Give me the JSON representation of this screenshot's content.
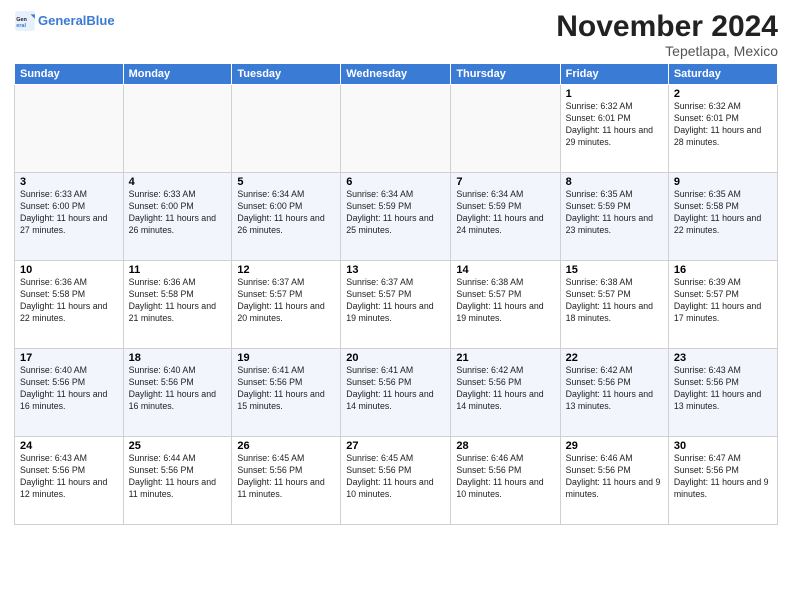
{
  "header": {
    "logo_line1": "General",
    "logo_line2": "Blue",
    "month": "November 2024",
    "location": "Tepetlapa, Mexico"
  },
  "days_of_week": [
    "Sunday",
    "Monday",
    "Tuesday",
    "Wednesday",
    "Thursday",
    "Friday",
    "Saturday"
  ],
  "weeks": [
    [
      {
        "day": "",
        "info": ""
      },
      {
        "day": "",
        "info": ""
      },
      {
        "day": "",
        "info": ""
      },
      {
        "day": "",
        "info": ""
      },
      {
        "day": "",
        "info": ""
      },
      {
        "day": "1",
        "info": "Sunrise: 6:32 AM\nSunset: 6:01 PM\nDaylight: 11 hours and 29 minutes."
      },
      {
        "day": "2",
        "info": "Sunrise: 6:32 AM\nSunset: 6:01 PM\nDaylight: 11 hours and 28 minutes."
      }
    ],
    [
      {
        "day": "3",
        "info": "Sunrise: 6:33 AM\nSunset: 6:00 PM\nDaylight: 11 hours and 27 minutes."
      },
      {
        "day": "4",
        "info": "Sunrise: 6:33 AM\nSunset: 6:00 PM\nDaylight: 11 hours and 26 minutes."
      },
      {
        "day": "5",
        "info": "Sunrise: 6:34 AM\nSunset: 6:00 PM\nDaylight: 11 hours and 26 minutes."
      },
      {
        "day": "6",
        "info": "Sunrise: 6:34 AM\nSunset: 5:59 PM\nDaylight: 11 hours and 25 minutes."
      },
      {
        "day": "7",
        "info": "Sunrise: 6:34 AM\nSunset: 5:59 PM\nDaylight: 11 hours and 24 minutes."
      },
      {
        "day": "8",
        "info": "Sunrise: 6:35 AM\nSunset: 5:59 PM\nDaylight: 11 hours and 23 minutes."
      },
      {
        "day": "9",
        "info": "Sunrise: 6:35 AM\nSunset: 5:58 PM\nDaylight: 11 hours and 22 minutes."
      }
    ],
    [
      {
        "day": "10",
        "info": "Sunrise: 6:36 AM\nSunset: 5:58 PM\nDaylight: 11 hours and 22 minutes."
      },
      {
        "day": "11",
        "info": "Sunrise: 6:36 AM\nSunset: 5:58 PM\nDaylight: 11 hours and 21 minutes."
      },
      {
        "day": "12",
        "info": "Sunrise: 6:37 AM\nSunset: 5:57 PM\nDaylight: 11 hours and 20 minutes."
      },
      {
        "day": "13",
        "info": "Sunrise: 6:37 AM\nSunset: 5:57 PM\nDaylight: 11 hours and 19 minutes."
      },
      {
        "day": "14",
        "info": "Sunrise: 6:38 AM\nSunset: 5:57 PM\nDaylight: 11 hours and 19 minutes."
      },
      {
        "day": "15",
        "info": "Sunrise: 6:38 AM\nSunset: 5:57 PM\nDaylight: 11 hours and 18 minutes."
      },
      {
        "day": "16",
        "info": "Sunrise: 6:39 AM\nSunset: 5:57 PM\nDaylight: 11 hours and 17 minutes."
      }
    ],
    [
      {
        "day": "17",
        "info": "Sunrise: 6:40 AM\nSunset: 5:56 PM\nDaylight: 11 hours and 16 minutes."
      },
      {
        "day": "18",
        "info": "Sunrise: 6:40 AM\nSunset: 5:56 PM\nDaylight: 11 hours and 16 minutes."
      },
      {
        "day": "19",
        "info": "Sunrise: 6:41 AM\nSunset: 5:56 PM\nDaylight: 11 hours and 15 minutes."
      },
      {
        "day": "20",
        "info": "Sunrise: 6:41 AM\nSunset: 5:56 PM\nDaylight: 11 hours and 14 minutes."
      },
      {
        "day": "21",
        "info": "Sunrise: 6:42 AM\nSunset: 5:56 PM\nDaylight: 11 hours and 14 minutes."
      },
      {
        "day": "22",
        "info": "Sunrise: 6:42 AM\nSunset: 5:56 PM\nDaylight: 11 hours and 13 minutes."
      },
      {
        "day": "23",
        "info": "Sunrise: 6:43 AM\nSunset: 5:56 PM\nDaylight: 11 hours and 13 minutes."
      }
    ],
    [
      {
        "day": "24",
        "info": "Sunrise: 6:43 AM\nSunset: 5:56 PM\nDaylight: 11 hours and 12 minutes."
      },
      {
        "day": "25",
        "info": "Sunrise: 6:44 AM\nSunset: 5:56 PM\nDaylight: 11 hours and 11 minutes."
      },
      {
        "day": "26",
        "info": "Sunrise: 6:45 AM\nSunset: 5:56 PM\nDaylight: 11 hours and 11 minutes."
      },
      {
        "day": "27",
        "info": "Sunrise: 6:45 AM\nSunset: 5:56 PM\nDaylight: 11 hours and 10 minutes."
      },
      {
        "day": "28",
        "info": "Sunrise: 6:46 AM\nSunset: 5:56 PM\nDaylight: 11 hours and 10 minutes."
      },
      {
        "day": "29",
        "info": "Sunrise: 6:46 AM\nSunset: 5:56 PM\nDaylight: 11 hours and 9 minutes."
      },
      {
        "day": "30",
        "info": "Sunrise: 6:47 AM\nSunset: 5:56 PM\nDaylight: 11 hours and 9 minutes."
      }
    ]
  ]
}
